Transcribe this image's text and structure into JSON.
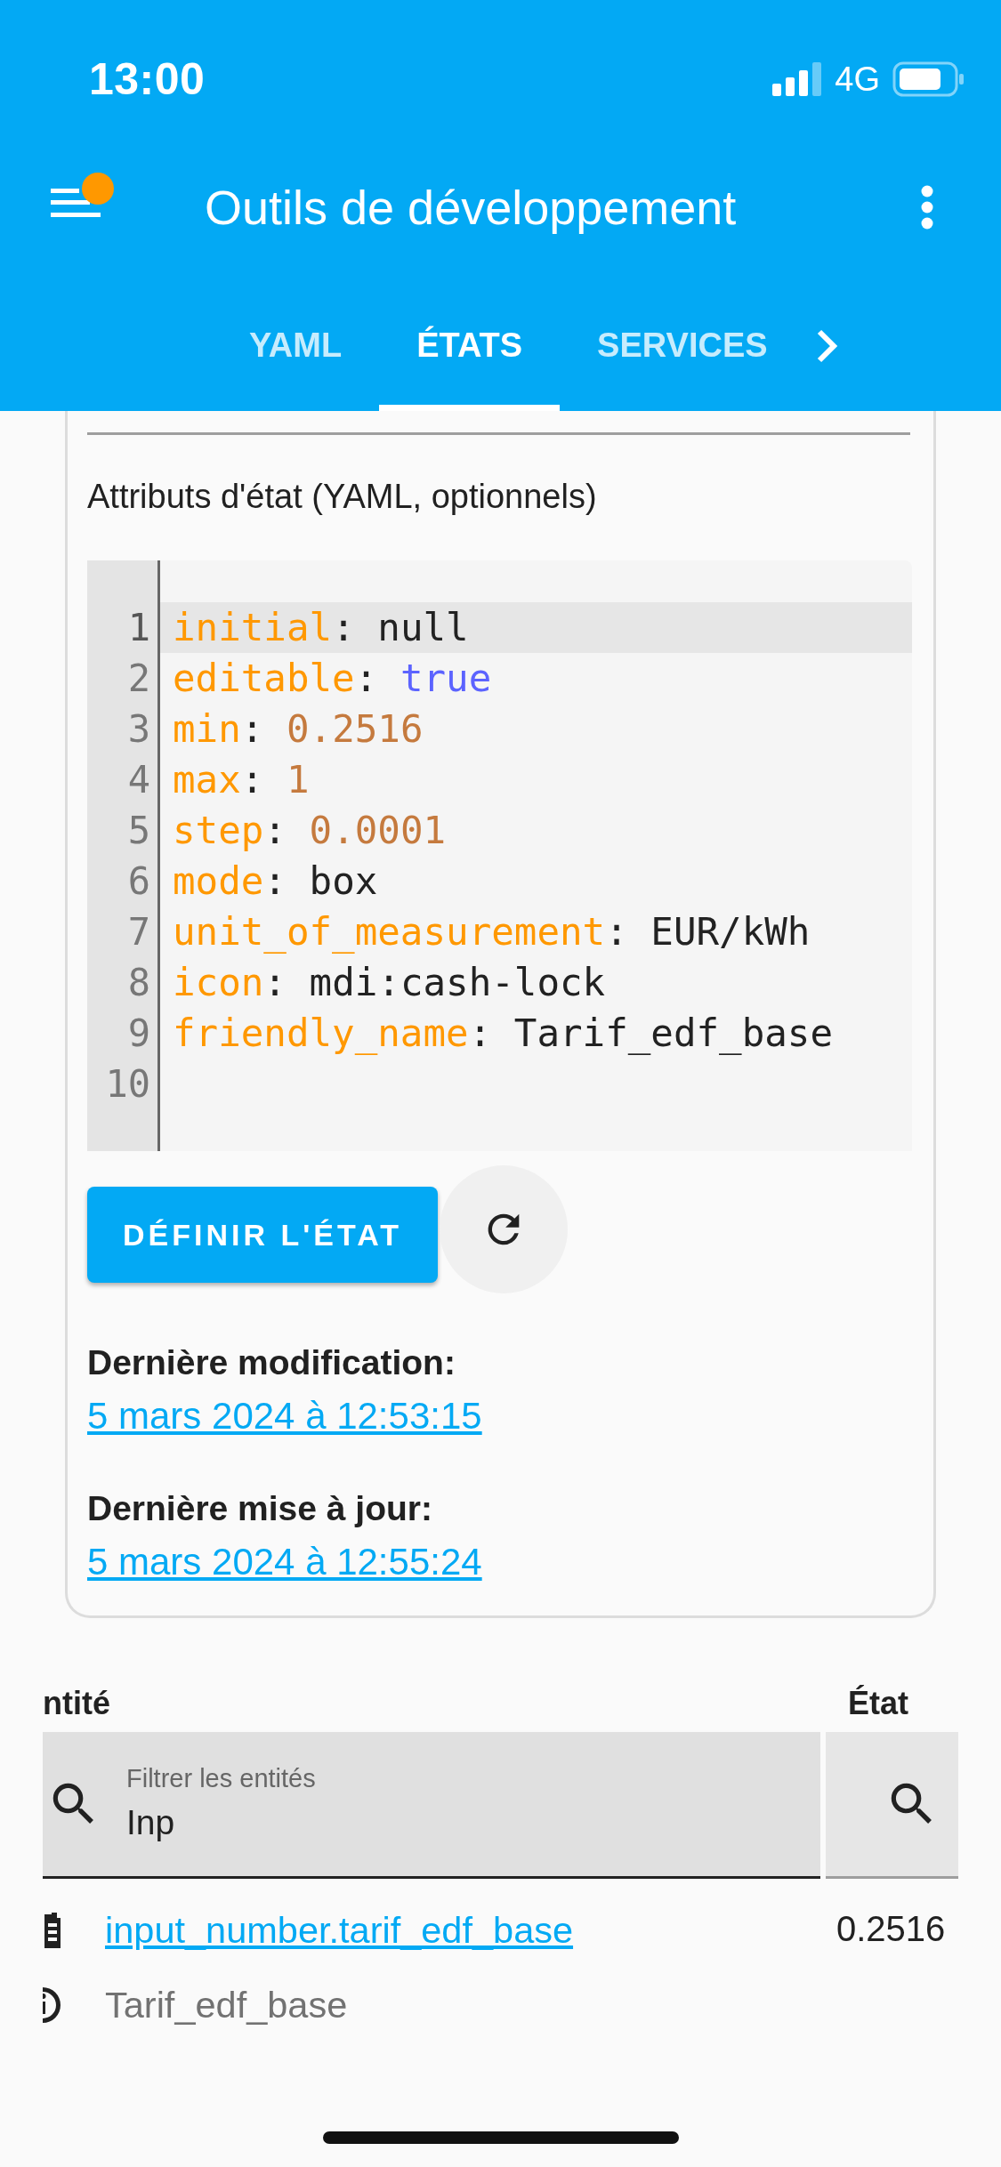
{
  "status_bar": {
    "time": "13:00",
    "network": "4G"
  },
  "toolbar": {
    "title": "Outils de développement"
  },
  "tabs": [
    {
      "label": "YAML",
      "selected": false
    },
    {
      "label": "ÉTATS",
      "selected": true
    },
    {
      "label": "SERVICES",
      "selected": false
    }
  ],
  "state_card": {
    "attributes_label": "Attributs d'état (YAML, optionnels)",
    "editor": {
      "lines": [
        {
          "number": "1",
          "active": true,
          "parts": [
            {
              "text": "initial",
              "kind": "key"
            },
            {
              "text": ": ",
              "kind": "punct"
            },
            {
              "text": "null",
              "kind": "plain"
            }
          ]
        },
        {
          "number": "2",
          "active": false,
          "parts": [
            {
              "text": "editable",
              "kind": "key"
            },
            {
              "text": ": ",
              "kind": "punct"
            },
            {
              "text": "true",
              "kind": "bool"
            }
          ]
        },
        {
          "number": "3",
          "active": false,
          "parts": [
            {
              "text": "min",
              "kind": "key"
            },
            {
              "text": ": ",
              "kind": "punct"
            },
            {
              "text": "0.2516",
              "kind": "number"
            }
          ]
        },
        {
          "number": "4",
          "active": false,
          "parts": [
            {
              "text": "max",
              "kind": "key"
            },
            {
              "text": ": ",
              "kind": "punct"
            },
            {
              "text": "1",
              "kind": "number"
            }
          ]
        },
        {
          "number": "5",
          "active": false,
          "parts": [
            {
              "text": "step",
              "kind": "key"
            },
            {
              "text": ": ",
              "kind": "punct"
            },
            {
              "text": "0.0001",
              "kind": "number"
            }
          ]
        },
        {
          "number": "6",
          "active": false,
          "parts": [
            {
              "text": "mode",
              "kind": "key"
            },
            {
              "text": ": ",
              "kind": "punct"
            },
            {
              "text": "box",
              "kind": "plain"
            }
          ]
        },
        {
          "number": "7",
          "active": false,
          "parts": [
            {
              "text": "unit_of_measurement",
              "kind": "key"
            },
            {
              "text": ": ",
              "kind": "punct"
            },
            {
              "text": "EUR/kWh",
              "kind": "plain"
            }
          ]
        },
        {
          "number": "8",
          "active": false,
          "parts": [
            {
              "text": "icon",
              "kind": "key"
            },
            {
              "text": ": ",
              "kind": "punct"
            },
            {
              "text": "mdi:cash-lock",
              "kind": "plain"
            }
          ]
        },
        {
          "number": "9",
          "active": false,
          "parts": [
            {
              "text": "friendly_name",
              "kind": "key"
            },
            {
              "text": ": ",
              "kind": "punct"
            },
            {
              "text": "Tarif_edf_base",
              "kind": "plain"
            }
          ]
        },
        {
          "number": "10",
          "active": false
        }
      ]
    },
    "set_state_button": "DÉFINIR L'ÉTAT",
    "last_changed": {
      "label": "Dernière modification:",
      "value": "5 mars 2024 à 12:53:15"
    },
    "last_updated": {
      "label": "Dernière mise à jour:",
      "value": "5 mars 2024 à 12:55:24"
    }
  },
  "table": {
    "columns": [
      {
        "label": "ntité",
        "filter_label": "Filtrer les entités",
        "filter_value": "Inp"
      },
      {
        "label": "État"
      }
    ],
    "rows": [
      {
        "entity_id": "input_number.tarif_edf_base",
        "friendly_name": "Tarif_edf_base",
        "state": "0.2516"
      }
    ]
  }
}
